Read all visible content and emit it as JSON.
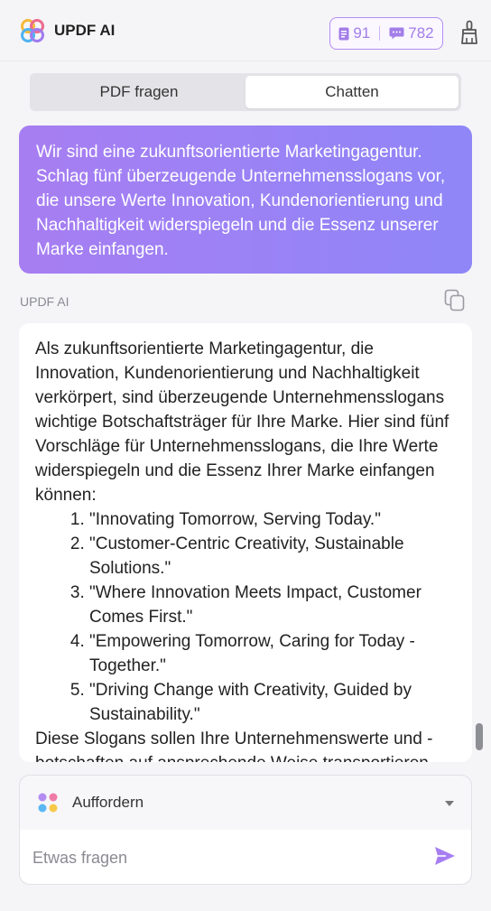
{
  "header": {
    "app_title": "UPDF AI",
    "pdf_count": "91",
    "chat_count": "782",
    "accent_color": "#a37ee8"
  },
  "tabs": [
    {
      "label": "PDF fragen",
      "active": false
    },
    {
      "label": "Chatten",
      "active": true
    }
  ],
  "user_message": "Wir sind eine zukunftsorientierte Marketingagentur. Schlag fünf überzeugende Unternehmensslogans vor, die unsere Werte Innovation, Kundenorientierung und Nachhaltigkeit widerspiegeln und die Essenz unserer Marke einfangen.",
  "ai_response": {
    "sender": "UPDF AI",
    "intro": "Als zukunftsorientierte Marketingagentur, die Innovation, Kundenorientierung und Nachhaltigkeit verkörpert, sind überzeugende Unternehmensslogans wichtige Botschaftsträger für Ihre Marke. Hier sind fünf Vorschläge für Unternehmensslogans, die Ihre Werte widerspiegeln und die Essenz Ihrer Marke einfangen können:",
    "slogans": [
      "\"Innovating Tomorrow, Serving Today.\"",
      "\"Customer-Centric Creativity, Sustainable Solutions.\"",
      "\"Where Innovation Meets Impact, Customer Comes First.\"",
      "\"Empowering Tomorrow, Caring for Today - Together.\"",
      "\"Driving Change with Creativity, Guided by Sustainability.\""
    ],
    "outro": "Diese Slogans sollen Ihre Unternehmenswerte und -botschaften auf ansprechende Weise transportieren."
  },
  "composer": {
    "prompt_label": "Auffordern",
    "input_placeholder": "Etwas fragen",
    "input_value": ""
  },
  "icons": {
    "logo": "updf-logo-icon",
    "pdf": "document-icon",
    "chat": "chat-bubble-icon",
    "clean": "broom-icon",
    "copy": "copy-icon",
    "prompt": "four-dots-icon",
    "dropdown": "caret-down-icon",
    "send": "send-icon"
  }
}
